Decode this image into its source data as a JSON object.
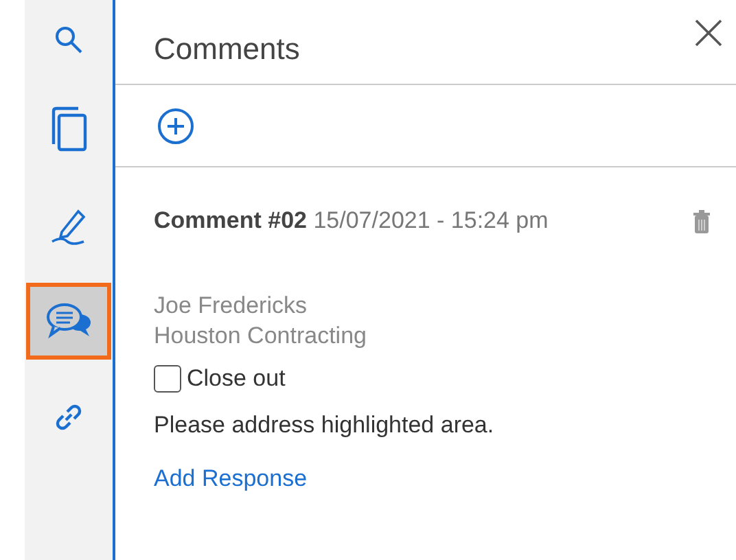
{
  "sidebar": {
    "items": [
      {
        "kind": "search",
        "selected": false
      },
      {
        "kind": "copy",
        "selected": false
      },
      {
        "kind": "sign",
        "selected": false
      },
      {
        "kind": "comments",
        "selected": true
      },
      {
        "kind": "link",
        "selected": false
      }
    ]
  },
  "panel": {
    "title": "Comments"
  },
  "comments": [
    {
      "number": "Comment #02",
      "date": "15/07/2021 - 15:24 pm",
      "author": "Joe Fredericks",
      "company": "Houston Contracting",
      "close_out": {
        "label": "Close out",
        "checked": false
      },
      "text": "Please address highlighted area.",
      "action": "Add Response"
    }
  ]
}
